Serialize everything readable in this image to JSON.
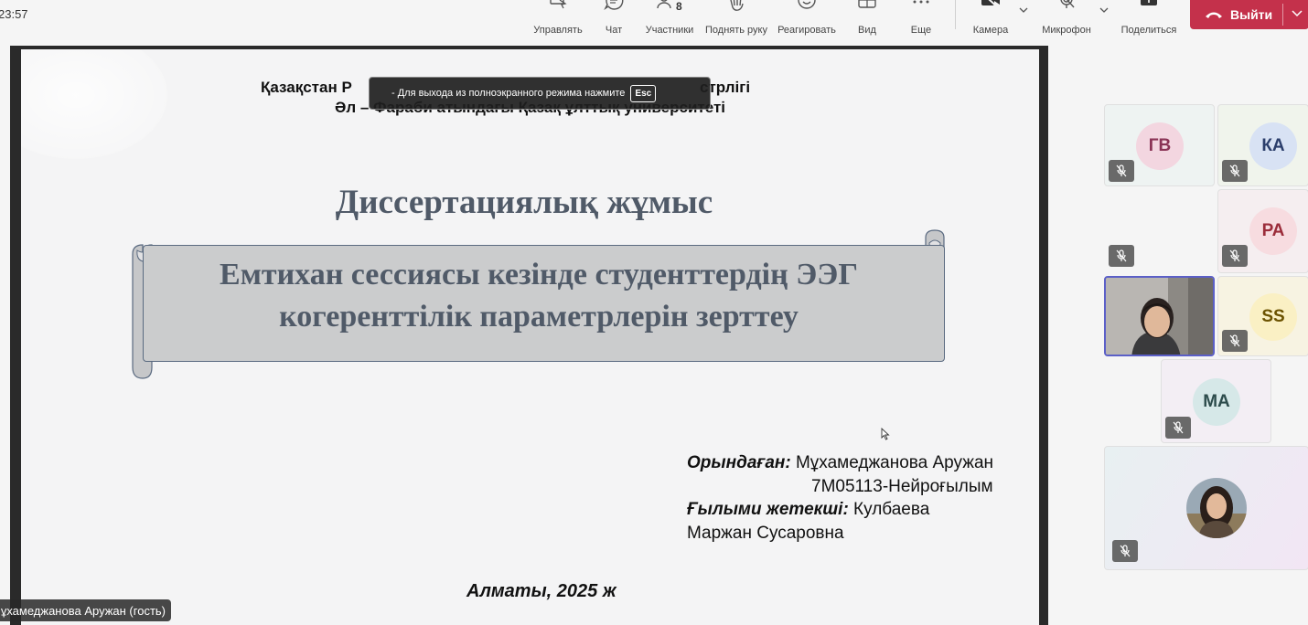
{
  "clock": "23:57",
  "toolbar": {
    "manage": "Управлять",
    "chat": "Чат",
    "participants": "Участники",
    "participants_count": "8",
    "raise_hand": "Поднять руку",
    "react": "Реагировать",
    "view": "Вид",
    "more": "Еще",
    "camera": "Камера",
    "mic": "Микрофон",
    "share": "Поделиться",
    "leave": "Выйти"
  },
  "toast": {
    "text": "- Для выхода из полноэкранного режима нажмите",
    "key": "Esc"
  },
  "slide": {
    "header_line1": "Қазақстан Р                                                    стрлігі",
    "header_line1_left": "Қазақстан Р",
    "header_line1_right": "стрлігі",
    "header_line2": "Әл – Фараби атындағы Қазақ ұлттық университеті",
    "subtitle": "Диссертациялық жұмыс",
    "title_line1": "Емтихан сессиясы кезінде студенттердің ЭЭГ",
    "title_line2": "когеренттілік параметрлерін зерттеу",
    "performed_label": "Орындаған:",
    "performed_name": " Мұхамеджанова Аружан",
    "program": "7M05113-Нейроғылым",
    "supervisor_label": "Ғылыми жетекші:",
    "supervisor_name1": " Кулбаева",
    "supervisor_name2": "Маржан Сусаровна",
    "city": "Алматы, 2025 ж"
  },
  "presenter_tag": "Мұхамеджанова Аружан (гость)",
  "participants": [
    {
      "initials": "ГВ",
      "color": "#f3d6e0",
      "text_color": "#8a3355"
    },
    {
      "initials": "КА",
      "color": "#d8e2f4",
      "text_color": "#2b3e6b"
    },
    {
      "initials": "РА",
      "color": "#f7dce0",
      "text_color": "#9b2c3a"
    },
    {
      "initials": "SS",
      "color": "#faf0c4",
      "text_color": "#6b5200"
    },
    {
      "initials": "МА",
      "color": "#d6e8e8",
      "text_color": "#2d4c4c"
    }
  ],
  "colors": {
    "leave": "#c4314b",
    "active_border": "#5b5fc7",
    "slide_text": "#505a68"
  }
}
